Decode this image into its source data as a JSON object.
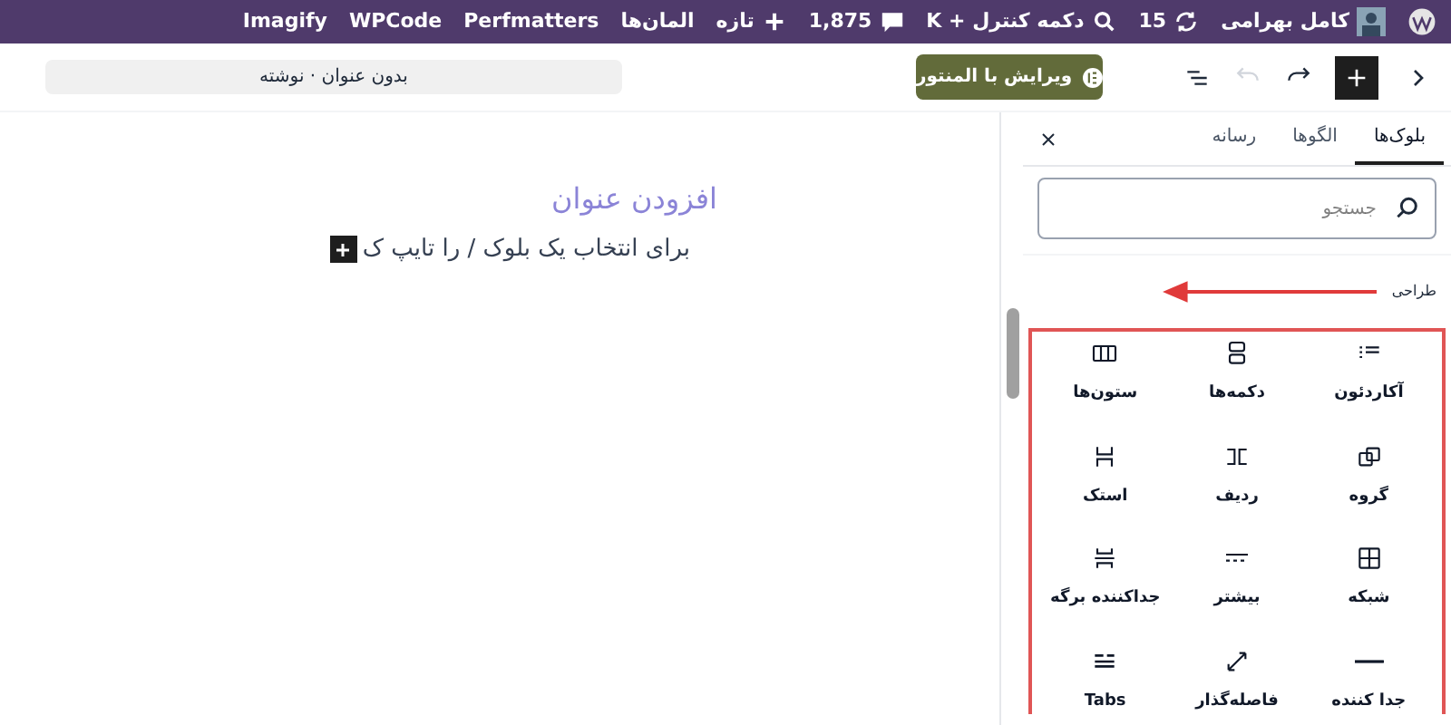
{
  "admin_bar": {
    "items": [
      {
        "kind": "wp-logo"
      },
      {
        "kind": "user",
        "label": "کامل بهرامی"
      },
      {
        "kind": "updates",
        "label": "15"
      },
      {
        "kind": "search",
        "label": "دکمه کنترل + K"
      },
      {
        "kind": "comments",
        "label": "1,875"
      },
      {
        "kind": "new",
        "label": "تازه"
      },
      {
        "kind": "text",
        "label": "المان‌ها"
      },
      {
        "kind": "text",
        "label": "Perfmatters"
      },
      {
        "kind": "text",
        "label": "WPCode"
      },
      {
        "kind": "text",
        "label": "Imagify"
      }
    ]
  },
  "header": {
    "elementor_button": "ویرایش با المنتور",
    "document_title": "بدون عنوان · نوشته",
    "undo_disabled": true
  },
  "editor": {
    "title_placeholder": "افزودن عنوان",
    "paragraph_placeholder": "برای انتخاب یک بلوک / را تایپ ک"
  },
  "inserter": {
    "tabs": [
      {
        "label": "بلوک‌ها",
        "selected": true
      },
      {
        "label": "الگوها",
        "selected": false
      },
      {
        "label": "رسانه",
        "selected": false
      }
    ],
    "search": {
      "placeholder": "جستجو"
    },
    "category": "طراحی",
    "blocks": [
      {
        "kind": "accordion",
        "label": "آکاردئون"
      },
      {
        "kind": "buttons",
        "label": "دکمه‌ها"
      },
      {
        "kind": "columns",
        "label": "ستون‌ها"
      },
      {
        "kind": "group",
        "label": "گروه"
      },
      {
        "kind": "row",
        "label": "ردیف"
      },
      {
        "kind": "stack",
        "label": "استک"
      },
      {
        "kind": "grid",
        "label": "شبکه"
      },
      {
        "kind": "more",
        "label": "بیشتر"
      },
      {
        "kind": "page-break",
        "label": "جداکننده برگه"
      },
      {
        "kind": "separator",
        "label": "جدا کننده"
      },
      {
        "kind": "spacer",
        "label": "فاصله‌گذار"
      },
      {
        "kind": "tabs",
        "label": "Tabs"
      }
    ]
  }
}
